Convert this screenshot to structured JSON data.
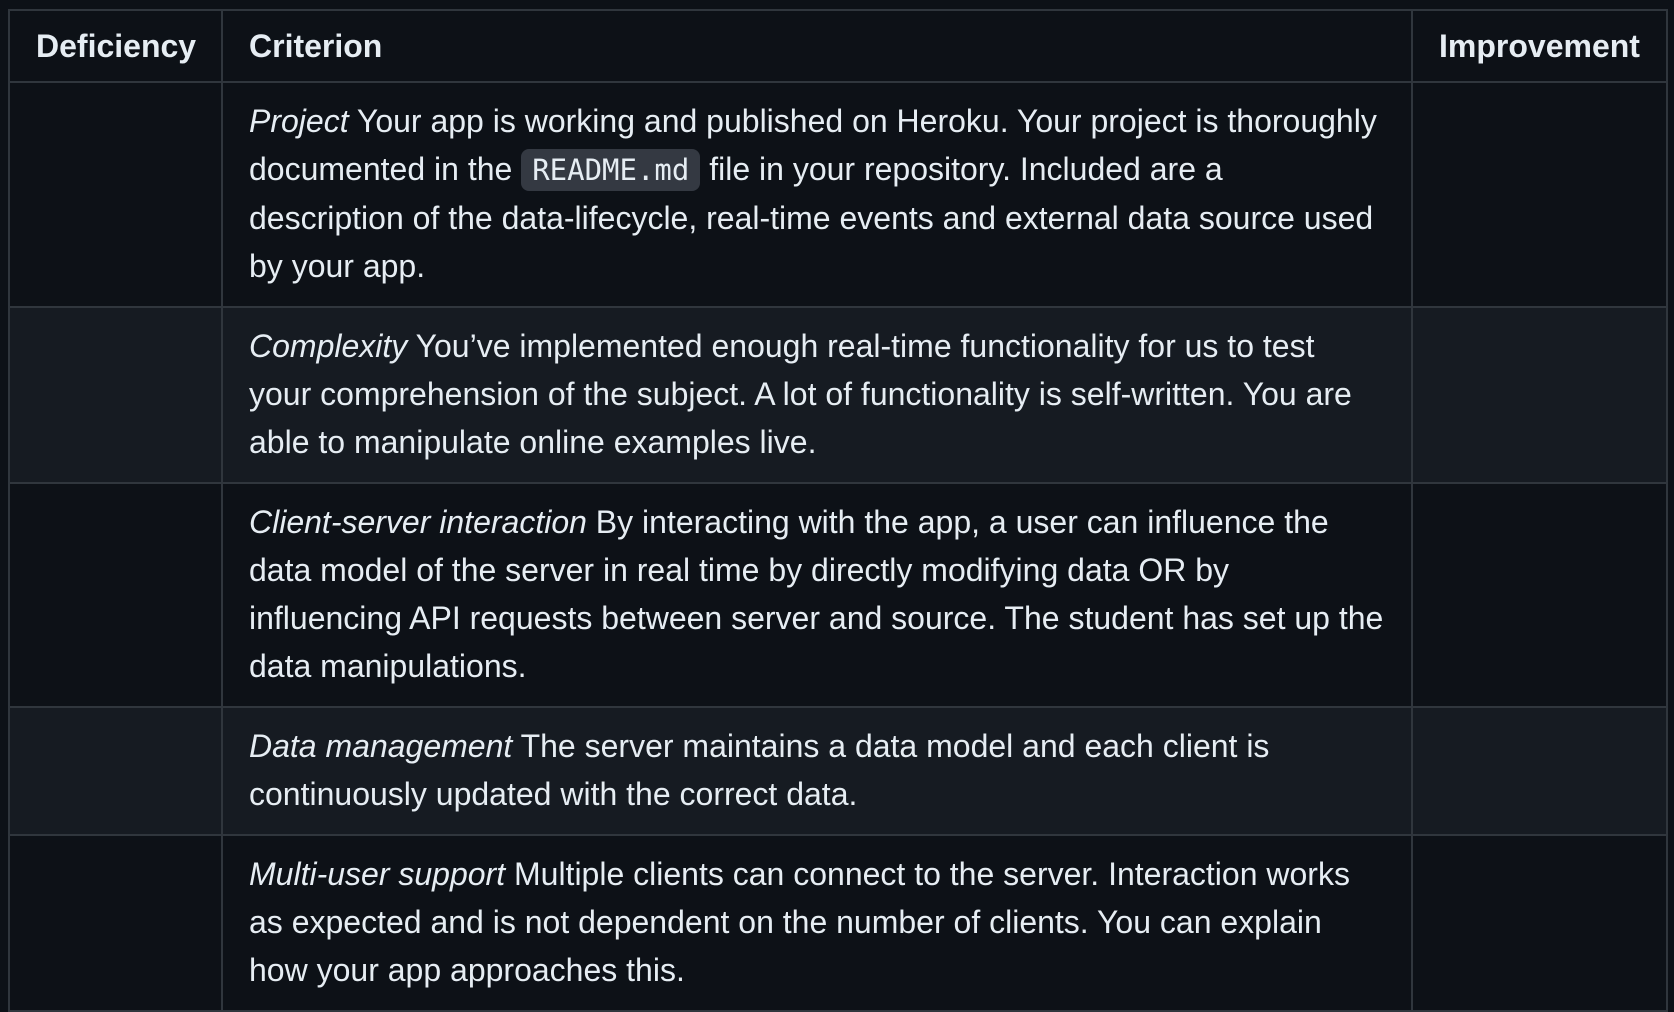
{
  "table": {
    "headers": {
      "deficiency": "Deficiency",
      "criterion": "Criterion",
      "improvement": "Improvement"
    },
    "rows": [
      {
        "deficiency": "",
        "title": "Project",
        "text_before_code": " Your app is working and published on Heroku. Your project is thoroughly documented in the ",
        "code": "README.md",
        "text_after_code": " file in your repository. Included are a description of the data-lifecycle, real-time events and external data source used by your app.",
        "improvement": ""
      },
      {
        "deficiency": "",
        "title": "Complexity",
        "text": " You’ve implemented enough real-time functionality for us to test your comprehension of the subject. A lot of functionality is self-written. You are able to manipulate online examples live.",
        "improvement": ""
      },
      {
        "deficiency": "",
        "title": "Client-server interaction",
        "text": " By interacting with the app, a user can influence the data model of the server in real time by directly modifying data OR by influencing API requests between server and source. The student has set up the data manipulations.",
        "improvement": ""
      },
      {
        "deficiency": "",
        "title": "Data management",
        "text": " The server maintains a data model and each client is continuously updated with the correct data.",
        "improvement": ""
      },
      {
        "deficiency": "",
        "title": "Multi-user support",
        "text": " Multiple clients can connect to the server. Interaction works as expected and is not dependent on the number of clients. You can explain how your app approaches this.",
        "improvement": ""
      }
    ]
  },
  "colors": {
    "background": "#0d1117",
    "row_alt": "#161b22",
    "border": "#30363d",
    "text": "#e6edf3",
    "code_bg": "#343942"
  }
}
